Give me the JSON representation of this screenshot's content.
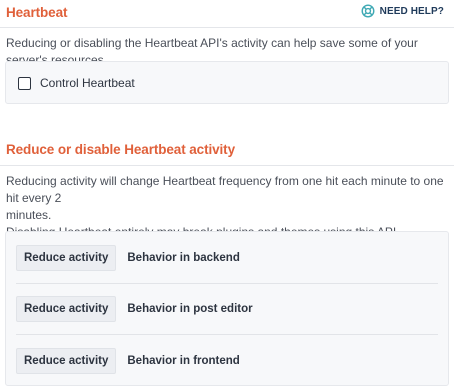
{
  "heartbeat": {
    "title": "Heartbeat",
    "help_label": "NEED HELP?",
    "help_icon": "lifebuoy-icon",
    "description": "Reducing or disabling the Heartbeat API's activity can help save some of your server's resources.",
    "control_label": "Control Heartbeat",
    "control_checked": false
  },
  "reduce": {
    "title": "Reduce or disable Heartbeat activity",
    "description_line1": "Reducing activity will change Heartbeat frequency from one hit each minute to one hit every 2",
    "description_line2": "minutes.",
    "description_line3": "Disabling Heartbeat entirely may break plugins and themes using this API.",
    "rows": [
      {
        "select_value": "Reduce activity",
        "label": "Behavior in backend"
      },
      {
        "select_value": "Reduce activity",
        "label": "Behavior in post editor"
      },
      {
        "select_value": "Reduce activity",
        "label": "Behavior in frontend"
      }
    ]
  },
  "colors": {
    "accent": "#e0603a",
    "help_text": "#1f3a5a",
    "help_icon": "#3fa9b4"
  }
}
